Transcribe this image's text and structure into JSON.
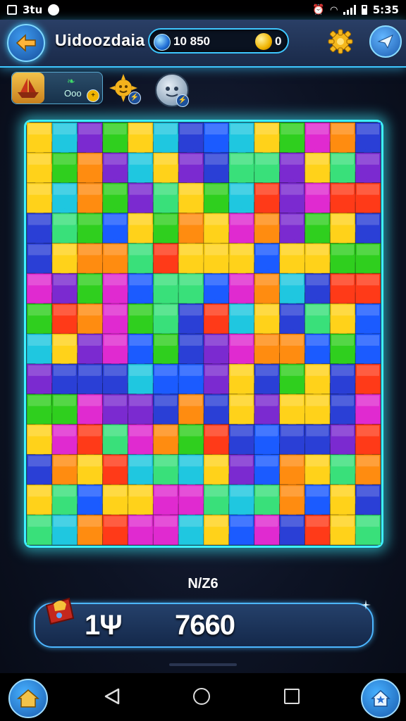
{
  "status_bar": {
    "left_text": "3tu",
    "time": "5:35"
  },
  "header": {
    "title": "Uidoozdaia",
    "gems_value": "10 850",
    "coins_value": "0"
  },
  "boosters": {
    "card_label": "Ooo"
  },
  "board": {
    "columns": 14,
    "rows": 14,
    "palette": [
      "#2a3fd6",
      "#7b2ad0",
      "#2fcf1e",
      "#ff3a18",
      "#ffd21a",
      "#1fc7e0",
      "#ff8c10",
      "#e02ad0",
      "#1b5bff",
      "#39e07a"
    ]
  },
  "level_label": "N/Z6",
  "score_bar": {
    "moves": "1Ψ",
    "score": "7660"
  },
  "icons": {
    "back": "arrow-left-icon",
    "settings": "gear-icon",
    "send": "paper-plane-icon",
    "gem": "gem-icon",
    "coin": "coin-icon"
  }
}
